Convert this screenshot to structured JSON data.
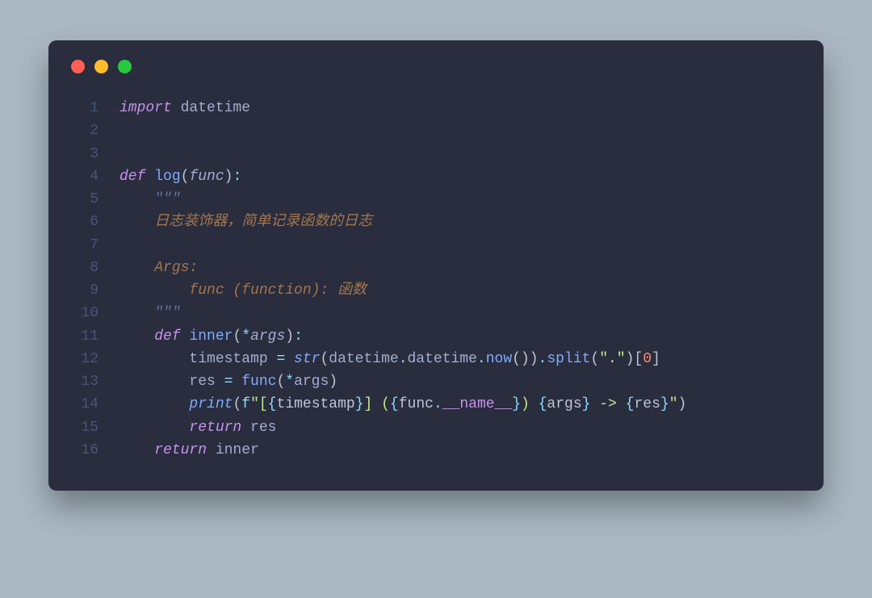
{
  "window": {
    "traffic_light_colors": {
      "red": "#ff5f56",
      "yellow": "#ffbd2e",
      "green": "#27c93f"
    }
  },
  "code": {
    "line_count": 16,
    "lines": [
      {
        "n": 1,
        "tokens": [
          {
            "t": "import",
            "c": "tok-kw"
          },
          {
            "t": " datetime",
            "c": ""
          }
        ]
      },
      {
        "n": 2,
        "tokens": []
      },
      {
        "n": 3,
        "tokens": []
      },
      {
        "n": 4,
        "tokens": [
          {
            "t": "def ",
            "c": "tok-kw"
          },
          {
            "t": "log",
            "c": "tok-def"
          },
          {
            "t": "(",
            "c": "tok-paren"
          },
          {
            "t": "func",
            "c": "tok-param"
          },
          {
            "t": ")",
            "c": "tok-paren"
          },
          {
            "t": ":",
            "c": "tok-op"
          }
        ]
      },
      {
        "n": 5,
        "tokens": [
          {
            "t": "    ",
            "c": ""
          },
          {
            "t": "\"\"\"",
            "c": "tok-doc"
          }
        ]
      },
      {
        "n": 6,
        "tokens": [
          {
            "t": "    ",
            "c": ""
          },
          {
            "t": "日志装饰器，简单记录函数的日志",
            "c": "tok-doc-cjk"
          }
        ]
      },
      {
        "n": 7,
        "tokens": []
      },
      {
        "n": 8,
        "tokens": [
          {
            "t": "    ",
            "c": ""
          },
          {
            "t": "Args:",
            "c": "tok-doc-cjk"
          }
        ]
      },
      {
        "n": 9,
        "tokens": [
          {
            "t": "        ",
            "c": ""
          },
          {
            "t": "func (function): ",
            "c": "tok-doc-cjk"
          },
          {
            "t": "函数",
            "c": "tok-doc-cjk"
          }
        ]
      },
      {
        "n": 10,
        "tokens": [
          {
            "t": "    ",
            "c": ""
          },
          {
            "t": "\"\"\"",
            "c": "tok-doc"
          }
        ]
      },
      {
        "n": 11,
        "tokens": [
          {
            "t": "    ",
            "c": ""
          },
          {
            "t": "def ",
            "c": "tok-kw"
          },
          {
            "t": "inner",
            "c": "tok-def"
          },
          {
            "t": "(",
            "c": "tok-paren"
          },
          {
            "t": "*",
            "c": "tok-op"
          },
          {
            "t": "args",
            "c": "tok-param"
          },
          {
            "t": ")",
            "c": "tok-paren"
          },
          {
            "t": ":",
            "c": "tok-op"
          }
        ]
      },
      {
        "n": 12,
        "tokens": [
          {
            "t": "        timestamp ",
            "c": ""
          },
          {
            "t": "= ",
            "c": "tok-op"
          },
          {
            "t": "str",
            "c": "tok-builtin"
          },
          {
            "t": "(",
            "c": "tok-paren"
          },
          {
            "t": "datetime",
            "c": ""
          },
          {
            "t": ".",
            "c": "tok-op"
          },
          {
            "t": "datetime",
            "c": ""
          },
          {
            "t": ".",
            "c": "tok-op"
          },
          {
            "t": "now",
            "c": "tok-fn"
          },
          {
            "t": "())",
            "c": "tok-paren"
          },
          {
            "t": ".",
            "c": "tok-op"
          },
          {
            "t": "split",
            "c": "tok-fn"
          },
          {
            "t": "(",
            "c": "tok-paren"
          },
          {
            "t": "\".\"",
            "c": "tok-str"
          },
          {
            "t": ")[",
            "c": "tok-paren"
          },
          {
            "t": "0",
            "c": "tok-num"
          },
          {
            "t": "]",
            "c": "tok-paren"
          }
        ]
      },
      {
        "n": 13,
        "tokens": [
          {
            "t": "        res ",
            "c": ""
          },
          {
            "t": "= ",
            "c": "tok-op"
          },
          {
            "t": "func",
            "c": "tok-fn"
          },
          {
            "t": "(",
            "c": "tok-paren"
          },
          {
            "t": "*",
            "c": "tok-op"
          },
          {
            "t": "args",
            "c": ""
          },
          {
            "t": ")",
            "c": "tok-paren"
          }
        ]
      },
      {
        "n": 14,
        "tokens": [
          {
            "t": "        ",
            "c": ""
          },
          {
            "t": "print",
            "c": "tok-builtin"
          },
          {
            "t": "(",
            "c": "tok-paren"
          },
          {
            "t": "f",
            "c": "tok-op"
          },
          {
            "t": "\"[",
            "c": "tok-str"
          },
          {
            "t": "{",
            "c": "tok-op"
          },
          {
            "t": "timestamp",
            "c": "tok-fstr-var"
          },
          {
            "t": "}",
            "c": "tok-op"
          },
          {
            "t": "] (",
            "c": "tok-str"
          },
          {
            "t": "{",
            "c": "tok-op"
          },
          {
            "t": "func",
            "c": "tok-fstr-var"
          },
          {
            "t": ".",
            "c": "tok-op"
          },
          {
            "t": "__name__",
            "c": "tok-dunder"
          },
          {
            "t": "}",
            "c": "tok-op"
          },
          {
            "t": ") ",
            "c": "tok-str"
          },
          {
            "t": "{",
            "c": "tok-op"
          },
          {
            "t": "args",
            "c": "tok-fstr-var"
          },
          {
            "t": "}",
            "c": "tok-op"
          },
          {
            "t": " -> ",
            "c": "tok-str"
          },
          {
            "t": "{",
            "c": "tok-op"
          },
          {
            "t": "res",
            "c": "tok-fstr-var"
          },
          {
            "t": "}",
            "c": "tok-op"
          },
          {
            "t": "\"",
            "c": "tok-str"
          },
          {
            "t": ")",
            "c": "tok-paren"
          }
        ]
      },
      {
        "n": 15,
        "tokens": [
          {
            "t": "        ",
            "c": ""
          },
          {
            "t": "return",
            "c": "tok-kw"
          },
          {
            "t": " res",
            "c": ""
          }
        ]
      },
      {
        "n": 16,
        "tokens": [
          {
            "t": "    ",
            "c": ""
          },
          {
            "t": "return",
            "c": "tok-kw"
          },
          {
            "t": " inner",
            "c": ""
          }
        ]
      }
    ]
  }
}
